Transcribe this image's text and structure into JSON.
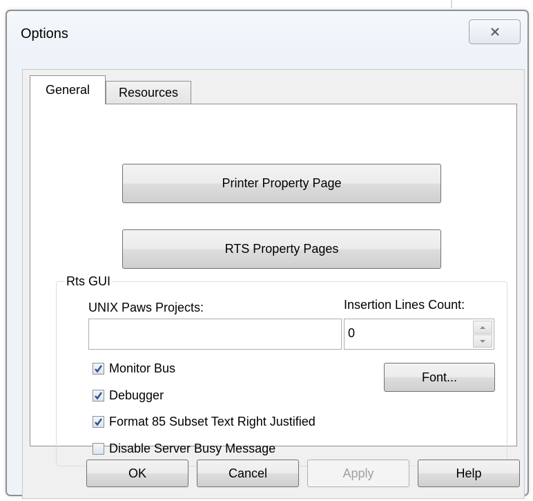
{
  "window": {
    "title": "Options",
    "close_glyph": "close-icon"
  },
  "tabs": [
    {
      "label": "General",
      "selected": true
    },
    {
      "label": "Resources",
      "selected": false
    }
  ],
  "general": {
    "printer_button": "Printer Property Page",
    "rts_button": "RTS Property Pages",
    "group": {
      "label": "Rts GUI",
      "unix_label": "UNIX Paws Projects:",
      "unix_value": "",
      "insertion_label": "Insertion Lines Count:",
      "insertion_value": "0",
      "checkboxes": [
        {
          "label": "Monitor Bus",
          "checked": true
        },
        {
          "label": "Debugger",
          "checked": true
        },
        {
          "label": "Format 85 Subset Text Right Justified",
          "checked": true
        },
        {
          "label": "Disable Server Busy Message",
          "checked": false
        }
      ],
      "font_button": "Font..."
    }
  },
  "footer": {
    "ok": "OK",
    "cancel": "Cancel",
    "apply": "Apply",
    "apply_enabled": false,
    "help": "Help"
  },
  "colors": {
    "check": "#2c4f91",
    "frame": "#8f8f8f"
  }
}
